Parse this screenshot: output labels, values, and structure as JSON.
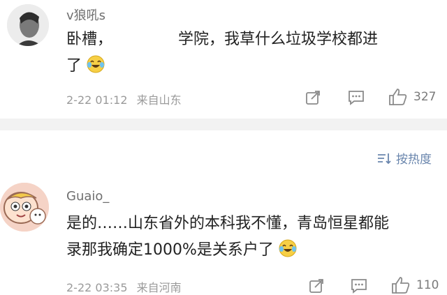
{
  "comments": [
    {
      "username": "v狼吼s",
      "text_line1": "卧槽，",
      "text_line1b": "学院，我草什么垃圾学校都进",
      "text_line2": "了",
      "emoji": "laugh-cry-emoji",
      "timestamp": "2-22 01:12",
      "location": "来自山东",
      "like_count": "327"
    },
    {
      "username": "Guaio_",
      "text_line1": "是的……山东省外的本科我不懂，青岛恒星都能",
      "text_line2": "录那我确定1000%是关系户了",
      "emoji": "laugh-cry-emoji",
      "timestamp": "2-22 03:35",
      "location": "来自河南",
      "like_count": "110"
    }
  ],
  "sort": {
    "label": "按热度",
    "icon": "sort-icon"
  },
  "icons": [
    "share-icon",
    "comment-icon",
    "like-icon"
  ]
}
